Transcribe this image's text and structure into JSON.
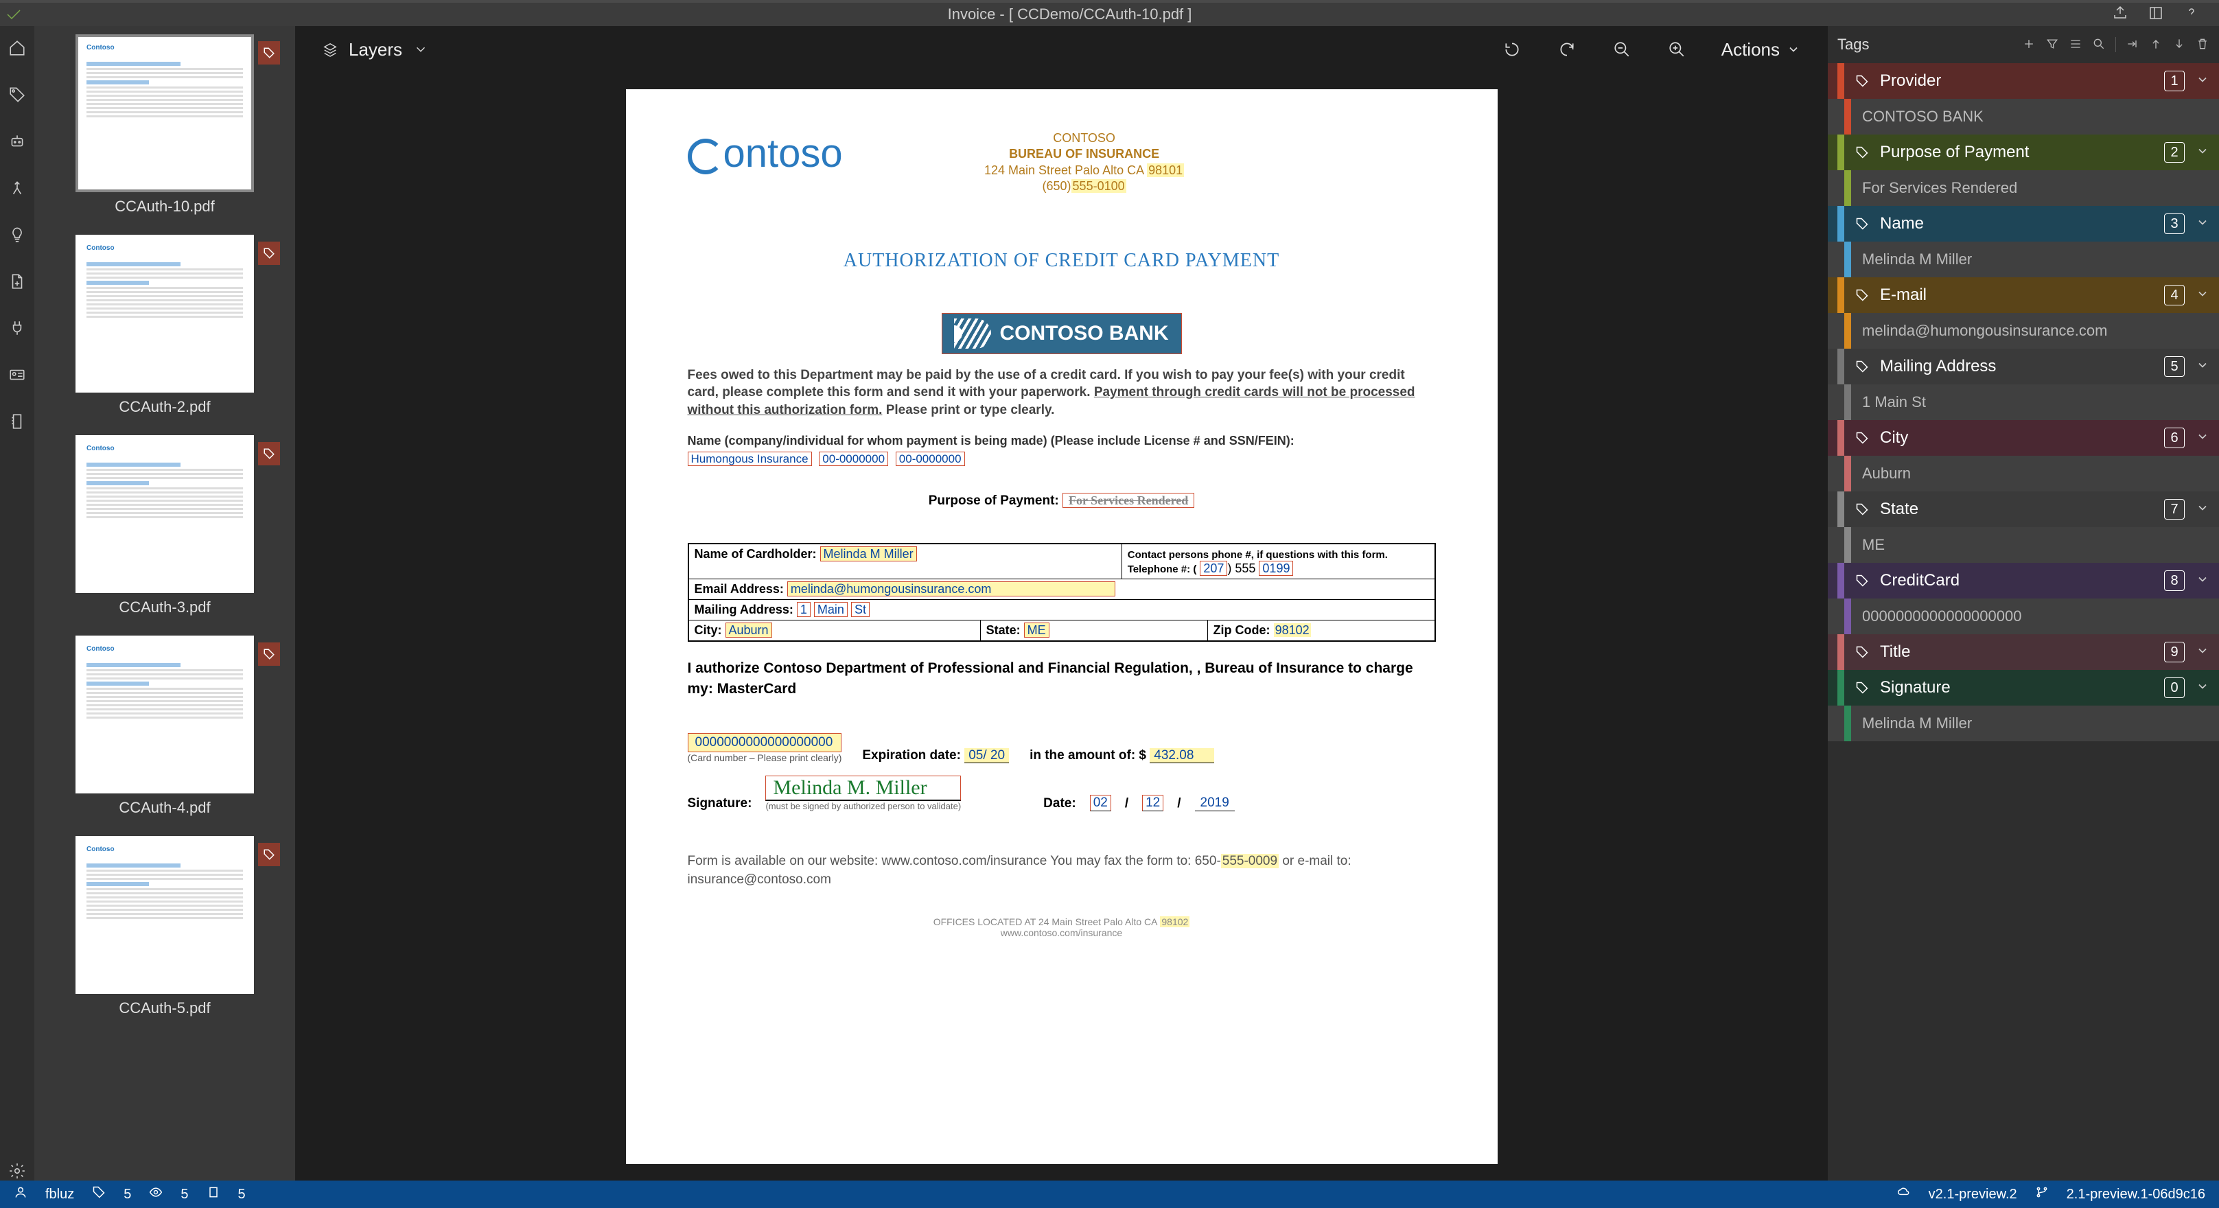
{
  "title": "Invoice - [ CCDemo/CCAuth-10.pdf ]",
  "layers_label": "Layers",
  "actions_label": "Actions",
  "tags_label": "Tags",
  "thumbs": [
    {
      "name": "CCAuth-10.pdf",
      "active": true
    },
    {
      "name": "CCAuth-2.pdf",
      "active": false
    },
    {
      "name": "CCAuth-3.pdf",
      "active": false
    },
    {
      "name": "CCAuth-4.pdf",
      "active": false
    },
    {
      "name": "CCAuth-5.pdf",
      "active": false
    }
  ],
  "doc": {
    "header": {
      "org": "CONTOSO",
      "dept": "BUREAU OF INSURANCE",
      "addr": "124 Main Street Palo Alto CA",
      "zip": "98101",
      "phone_pre": "(650)",
      "phone": "555-0100"
    },
    "logo_text": "ontoso",
    "section_title": "AUTHORIZATION OF CREDIT CARD PAYMENT",
    "bank": "CONTOSO BANK",
    "fees": "Fees owed to this Department may be paid by the use of a credit card.  If you wish to pay your fee(s) with your credit card, please complete this form and send it with your paperwork.  ",
    "fees_u": "Payment through credit cards will not be processed without this authorization form.",
    "fees_end": "  Please print or type clearly.",
    "name_label": "Name (company/individual for whom payment is being made) (Please include License # and SSN/FEIN):",
    "name_company": "Humongous Insurance",
    "name_lic": "00-0000000",
    "name_ssn": "00-0000000",
    "purpose_label": "Purpose of Payment:",
    "purpose_value": "For Services Rendered",
    "table": {
      "cardholder_l": "Name of Cardholder:",
      "cardholder_v": "Melinda M Miller",
      "contact": "Contact persons phone #, if questions with this form. Telephone #: (",
      "p1": "207",
      "pm": ")     555",
      "p2": "0199",
      "email_l": "Email Address:",
      "email_v": "melinda@humongousinsurance.com",
      "mail_l": "Mailing Address:",
      "mail_n": "1",
      "mail_s": "Main",
      "mail_e": "St",
      "city_l": "City:",
      "city_v": "Auburn",
      "state_l": "State:",
      "state_v": "ME",
      "zip_l": "Zip Code:",
      "zip_v": "98102"
    },
    "auth": "I authorize Contoso Department of Professional and Financial Regulation, , Bureau of Insurance to charge my:    MasterCard",
    "cc": {
      "num": "0000000000000000000",
      "exp_l": "Expiration date:",
      "exp_v": "05/ 20",
      "amt_l": "in the amount of: $",
      "amt_v": "432.08",
      "note": "(Card number – Please print clearly)"
    },
    "sig": {
      "l": "Signature:",
      "v": "Melinda M. Miller",
      "date_l": "Date:",
      "d1": "02",
      "d2": "12",
      "d3": "2019",
      "note": "(must be signed by authorized person to validate)"
    },
    "foot": {
      "l1": "Form is available on our website:  www.contoso.com/insurance You may fax the form to: 650-",
      "l1h": "555-0009",
      "l1e": "  or e-mail to:  insurance@contoso.com",
      "m1": "OFFICES LOCATED AT 24 Main Street Palo Alto CA",
      "m1h": "98102",
      "m2": "www.contoso.com/insurance"
    }
  },
  "tags": [
    {
      "name": "Provider",
      "count": "1",
      "value": "CONTOSO BANK",
      "hcolor": "#5a2a28",
      "vcolor": "#cf4b2e"
    },
    {
      "name": "Purpose of Payment",
      "count": "2",
      "value": "For Services Rendered",
      "hcolor": "#3a4a1e",
      "vcolor": "#8aa637"
    },
    {
      "name": "Name",
      "count": "3",
      "value": "Melinda M Miller",
      "hcolor": "#1e4557",
      "vcolor": "#4aa0d0"
    },
    {
      "name": "E-mail",
      "count": "4",
      "value": "melinda@humongousinsurance.com",
      "hcolor": "#5a4418",
      "vcolor": "#d88a1e"
    },
    {
      "name": "Mailing Address",
      "count": "5",
      "value": "1 Main St",
      "hcolor": "#3a3a3a",
      "vcolor": "#777"
    },
    {
      "name": "City",
      "count": "6",
      "value": "Auburn",
      "hcolor": "#4a2832",
      "vcolor": "#c76a6a"
    },
    {
      "name": "State",
      "count": "7",
      "value": "ME",
      "hcolor": "#3a3a3a",
      "vcolor": "#888"
    },
    {
      "name": "CreditCard",
      "count": "8",
      "value": "0000000000000000000",
      "hcolor": "#3a2e4a",
      "vcolor": "#7a5aa8"
    },
    {
      "name": "Title",
      "count": "9",
      "value": null,
      "hcolor": "#4a3238",
      "vcolor": "#c76a6a"
    },
    {
      "name": "Signature",
      "count": "0",
      "value": "Melinda M Miller",
      "hcolor": "#1e3a2e",
      "vcolor": "#2e8a5a"
    }
  ],
  "status": {
    "user": "fbluz",
    "n1": "5",
    "n2": "5",
    "n3": "5",
    "r1": "v2.1-preview.2",
    "r2": "2.1-preview.1-06d9c16"
  }
}
